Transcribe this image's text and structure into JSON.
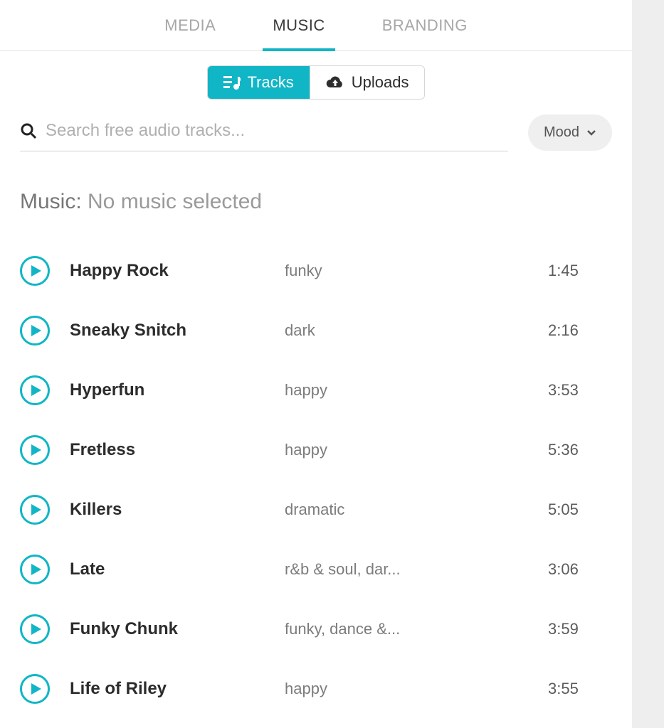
{
  "topnav": {
    "tabs": [
      {
        "label": "MEDIA",
        "active": false
      },
      {
        "label": "MUSIC",
        "active": true
      },
      {
        "label": "BRANDING",
        "active": false
      }
    ]
  },
  "segment": {
    "tracks_label": "Tracks",
    "uploads_label": "Uploads"
  },
  "search": {
    "placeholder": "Search free audio tracks..."
  },
  "mood_filter": {
    "label": "Mood"
  },
  "selection": {
    "prefix": "Music: ",
    "value": "No music selected"
  },
  "tracks": [
    {
      "name": "Happy Rock",
      "mood": "funky",
      "duration": "1:45"
    },
    {
      "name": "Sneaky Snitch",
      "mood": "dark",
      "duration": "2:16"
    },
    {
      "name": "Hyperfun",
      "mood": "happy",
      "duration": "3:53"
    },
    {
      "name": "Fretless",
      "mood": "happy",
      "duration": "5:36"
    },
    {
      "name": "Killers",
      "mood": "dramatic",
      "duration": "5:05"
    },
    {
      "name": "Late",
      "mood": "r&b & soul, dar...",
      "duration": "3:06"
    },
    {
      "name": "Funky Chunk",
      "mood": "funky, dance &...",
      "duration": "3:59"
    },
    {
      "name": "Life of Riley",
      "mood": "happy",
      "duration": "3:55"
    }
  ]
}
